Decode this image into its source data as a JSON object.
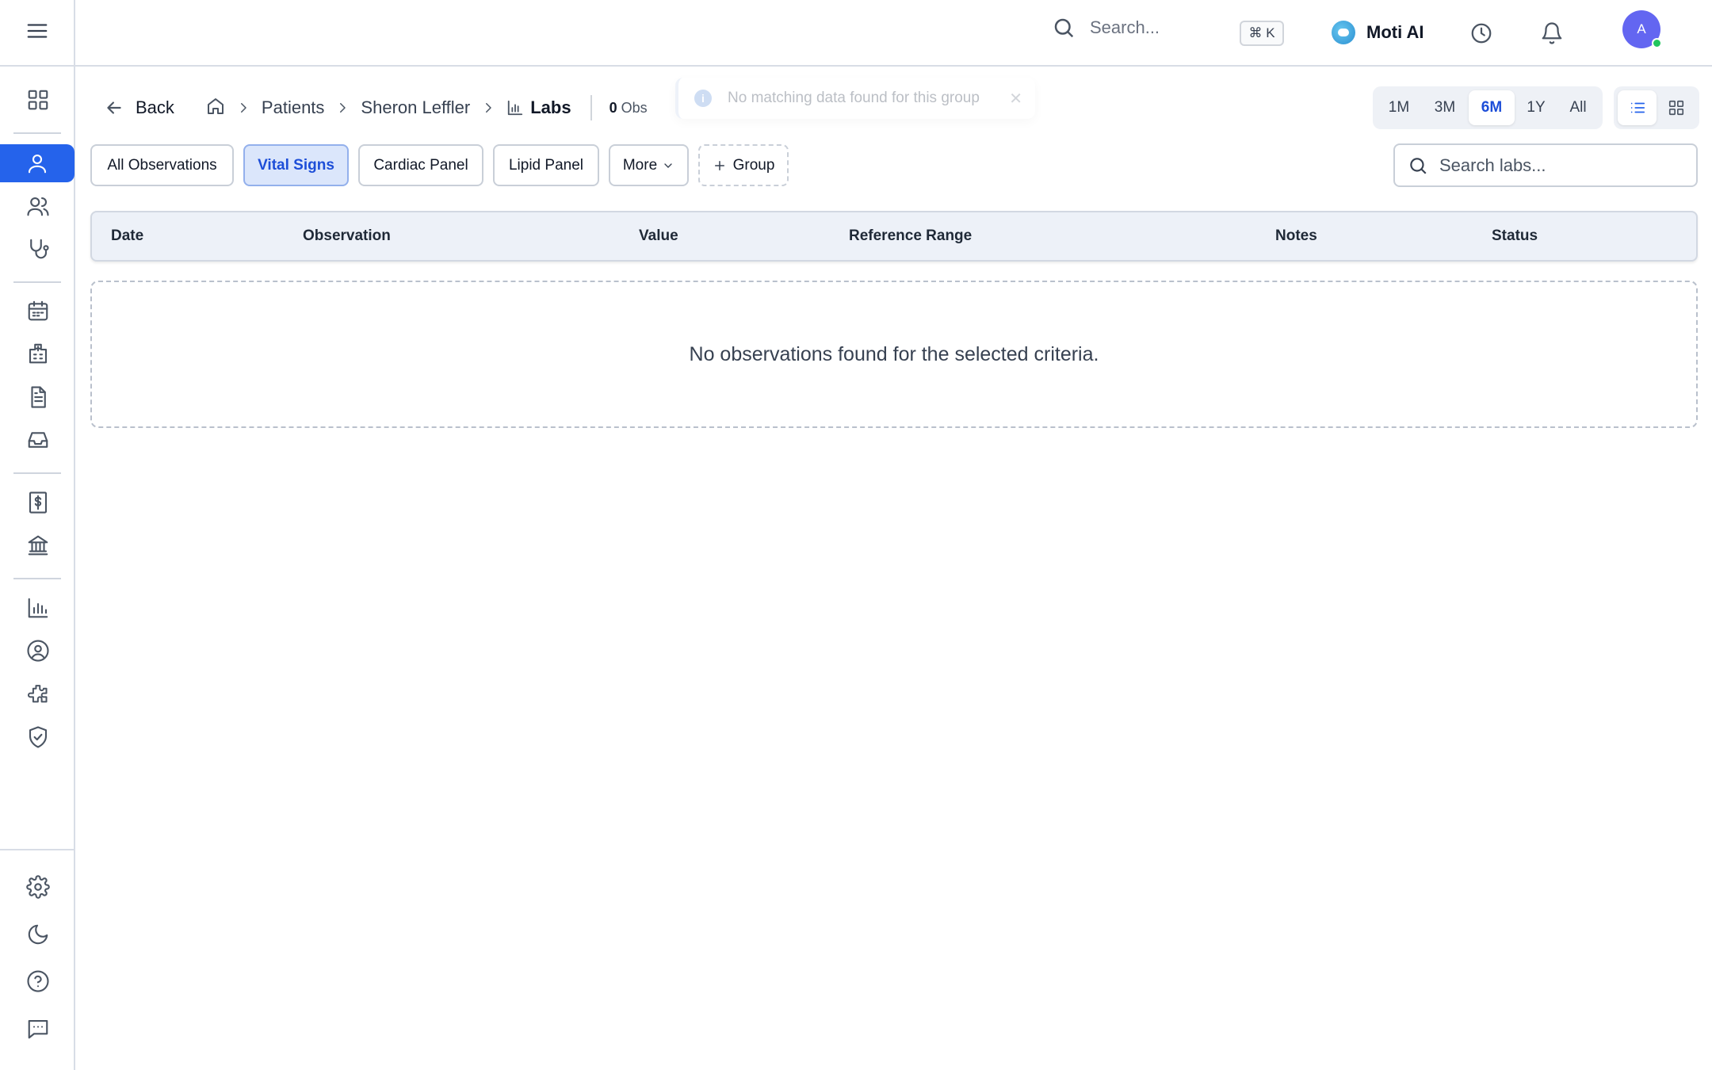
{
  "topbar": {
    "search_placeholder": "Search...",
    "shortcut": "⌘ K",
    "assistant_label": "Moti AI",
    "avatar_initial": "A"
  },
  "sidebar": {
    "icons": [
      "menu-icon",
      "dashboard-icon",
      "patient-icon",
      "users-icon",
      "stethoscope-icon",
      "calendar-icon",
      "hospital-icon",
      "document-icon",
      "inbox-icon",
      "billing-icon",
      "bank-icon",
      "analytics-icon",
      "profile-icon",
      "integrations-icon",
      "security-icon",
      "settings-icon",
      "dark-mode-icon",
      "help-icon",
      "chat-icon"
    ],
    "active": "patient-icon"
  },
  "breadcrumb": {
    "back": "Back",
    "patients": "Patients",
    "patient_name": "Sheron Leffler",
    "current": "Labs",
    "obs_count": "0",
    "obs_unit": "Obs"
  },
  "toast": {
    "message": "No matching data found for this group"
  },
  "time_range": {
    "options": [
      "1M",
      "3M",
      "6M",
      "1Y",
      "All"
    ],
    "selected": "6M"
  },
  "view_mode": {
    "selected": "list"
  },
  "groups": {
    "all": "All Observations",
    "vital": "Vital Signs",
    "cardiac": "Cardiac Panel",
    "lipid": "Lipid Panel",
    "more": "More",
    "add": "Group",
    "selected": "Vital Signs"
  },
  "search_labs": {
    "placeholder": "Search labs..."
  },
  "table": {
    "columns": [
      "Date",
      "Observation",
      "Value",
      "Reference Range",
      "Notes",
      "Status"
    ],
    "empty_message": "No observations found for the selected criteria."
  }
}
